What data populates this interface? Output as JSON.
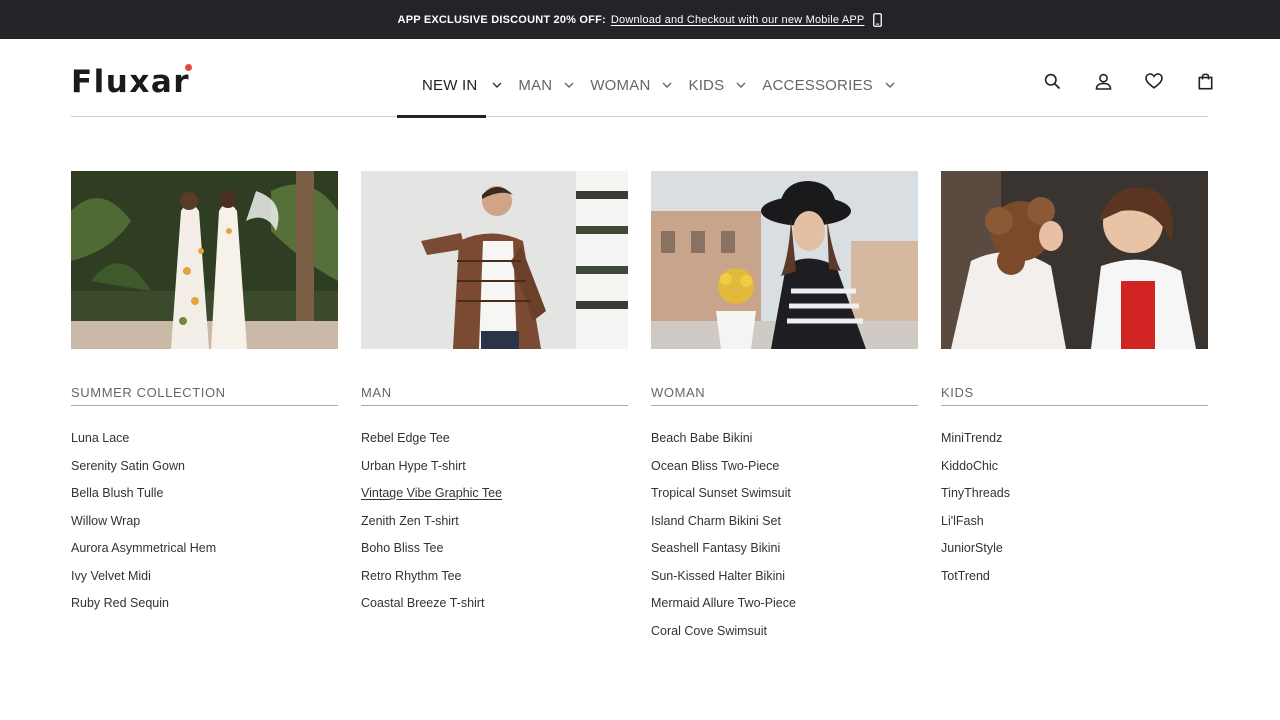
{
  "announcement": {
    "lead": "APP EXCLUSIVE DISCOUNT 20% OFF:",
    "link": "Download and Checkout with our new Mobile APP",
    "icon": "mobile-phone-icon"
  },
  "brand": {
    "logo_text": "Fluxar",
    "accent": "#e8463f"
  },
  "nav": [
    {
      "label": "NEW IN",
      "active": true
    },
    {
      "label": "MAN"
    },
    {
      "label": "WOMAN"
    },
    {
      "label": "KIDS"
    },
    {
      "label": "ACCESSORIES"
    }
  ],
  "header_icons": [
    "search-icon",
    "account-icon",
    "wishlist-heart-icon",
    "shopping-bag-icon"
  ],
  "columns": [
    {
      "heading": "SUMMER COLLECTION",
      "image": "two women in summer maxi dresses",
      "items": [
        "Luna Lace",
        "Serenity Satin Gown",
        "Bella Blush Tulle",
        "Willow Wrap",
        "Aurora Asymmetrical Hem",
        "Ivy Velvet Midi",
        "Ruby Red Sequin"
      ]
    },
    {
      "heading": "MAN",
      "image": "man in plaid flannel shirt",
      "items": [
        "Rebel Edge Tee",
        "Urban Hype T-shirt",
        "Vintage Vibe Graphic Tee",
        "Zenith Zen T-shirt",
        "Boho Bliss Tee",
        "Retro Rhythm Tee",
        "Coastal Breeze T-shirt"
      ]
    },
    {
      "heading": "WOMAN",
      "image": "woman in black hat at cafe",
      "items": [
        "Beach Babe Bikini",
        "Ocean Bliss Two-Piece",
        "Tropical Sunset Swimsuit",
        "Island Charm Bikini Set",
        "Seashell Fantasy Bikini",
        "Sun-Kissed Halter Bikini",
        "Mermaid Allure Two-Piece",
        "Coral Cove Swimsuit"
      ]
    },
    {
      "heading": "KIDS",
      "image": "two children whispering",
      "items": [
        "MiniTrendz",
        "KiddoChic",
        "TinyThreads",
        "Li'lFash",
        "JuniorStyle",
        "TotTrend"
      ]
    }
  ]
}
